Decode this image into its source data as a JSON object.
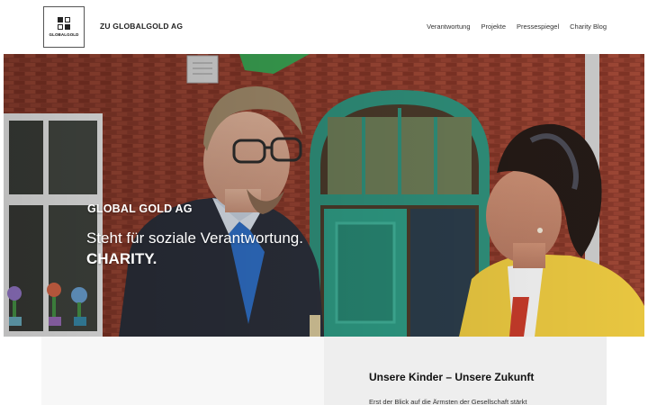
{
  "header": {
    "logo_text": "GLOBALGOLD",
    "brand_link": "ZU GLOBALGOLD AG",
    "nav": [
      {
        "label": "Verantwortung"
      },
      {
        "label": "Projekte"
      },
      {
        "label": "Pressespiegel"
      },
      {
        "label": "Charity Blog"
      }
    ]
  },
  "hero": {
    "company": "GLOBAL GOLD AG",
    "tagline": "Steht für soziale Verantwortung.",
    "highlight": "CHARITY."
  },
  "section": {
    "title": "Unsere Kinder – Unsere Zukunft",
    "text": "Erst der Blick auf die Ärmsten der Gesellschaft stärkt"
  },
  "colors": {
    "brick": "#8a3b2c",
    "door_teal": "#2f8f7a",
    "jacket_yellow": "#e8c640",
    "suit_dark": "#2b2f3a",
    "tie_blue": "#2f6fc6"
  }
}
